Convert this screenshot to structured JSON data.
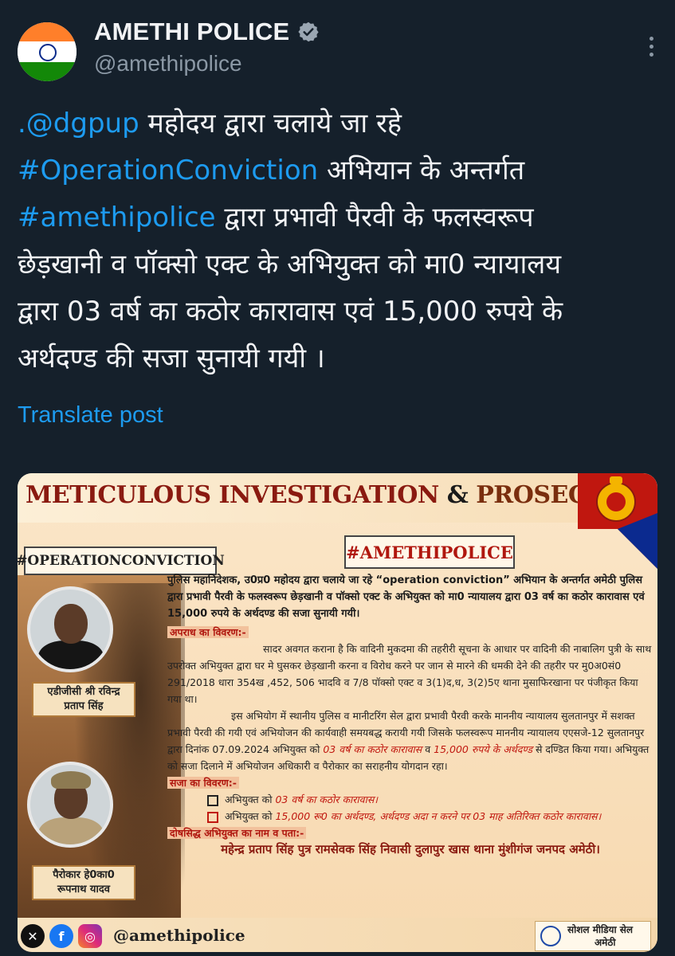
{
  "header": {
    "name": "AMETHI POLICE",
    "handle": "@amethipolice"
  },
  "tweet": {
    "lines": [
      {
        "link": ".@dgpup",
        "text": " महोदय द्वारा चलाये जा रहे"
      },
      {
        "link": "#OperationConviction",
        "text": " अभियान के अन्तर्गत"
      },
      {
        "link": "#amethipolice",
        "text": " द्वारा प्रभावी पैरवी के फलस्वरूप"
      },
      {
        "link": "",
        "text": "छेड़खानी व पॉक्सो एक्ट के अभियुक्त को मा0 न्यायालय"
      },
      {
        "link": "",
        "text": "द्वारा 03 वर्ष का कठोर कारावास एवं 15,000 रुपये के"
      },
      {
        "link": "",
        "text": "अर्थदण्ड की सजा सुनायी गयी ।"
      }
    ],
    "translate_label": "Translate post"
  },
  "card": {
    "title_a": "METICULOUS INVESTIGATION",
    "title_amp": " & ",
    "title_b": "PROSECUTION",
    "op_tag": "#OPERATIONCONVICTION",
    "ap_tag": "#AMETHIPOLICE",
    "person1": "एडीजीसी श्री रविन्द्र प्रताप सिंह",
    "person2": "पैरोकार हे0का0 रूपनाथ यादव",
    "intro": "पुलिस महानिदेशक, उ0प्र0 महोदय द्वारा चलाये जा रहे “operation conviction” अभियान के अन्तर्गत अमेठी पुलिस द्वारा प्रभावी पैरवी के फलस्वरूप छेड़खानी व पॉक्सो एक्ट के अभियुक्त को मा0 न्यायालय द्वारा 03 वर्ष का कठोर कारावास एवं 15,000 रुपये के अर्थदण्ड की सजा सुनायी गयी।",
    "heading_crime": "अपराध का विवरण:-",
    "para1": "सादर अवगत कराना है कि वादिनी मुकदमा की तहरीरी सूचना के आधार पर वादिनी की नाबालिग पुत्री के साथ उपरोक्त अभियुक्त द्वारा घर मे घुसकर छेड़खानी करना व विरोध करने पर जान से मारने की धमकी देने की तहरीर पर मु0अ0सं0 291/2018 धारा 354ख ,452, 506 भादवि व 7/8 पॉक्सो एक्ट व 3(1)द,ध, 3(2)5ए थाना मुसाफिरखाना पर पंजीकृत किया गया था।",
    "para2_a": "इस अभियोग में स्थानीय पुलिस व मानीटरिंग सेल द्वारा प्रभावी पैरवी करके माननीय न्यायालय सुलतानपुर में सशक्त प्रभावी पैरवी की गयी एवं अभियोजन की कार्यवाही समयबद्ध करायी गयी जिसके फलस्वरूप माननीय न्यायालय एएसजे-12 सुलतानपुर द्वारा दिनांक 07.09.2024 अभियुक्त को ",
    "para2_r1": "03 वर्ष का कठोर कारावास",
    "para2_b": " व ",
    "para2_r2": "15,000 रुपये के अर्थदण्ड",
    "para2_c": " से दण्डित किया गया। अभियुक्त को सजा दिलाने में अभियोजन अधिकारी व पैरोकार का सराहनीय योगदान रहा।",
    "heading_sentence": "सजा का विवरण:-",
    "s1_a": "अभियुक्त को ",
    "s1_r": "03 वर्ष का कठोर कारावास।",
    "s2_a": "अभियुक्त को ",
    "s2_r": "15,000 रू0 का अर्थदण्ड, अर्थदण्ड अदा न करने पर 03 माह अतिरिक्त कठोर कारावास।",
    "heading_accused": "दोषसिद्ध अभियुक्त का नाम व पता:-",
    "accused": "महेन्द्र प्रताप सिंह पुत्र रामसेवक सिंह निवासी दुलापुर खास थाना मुंशीगंज जनपद अमेठी।",
    "social_handle": "@amethipolice",
    "cell_line1": "सोशल मीडिया सेल",
    "cell_line2": "अमेठी"
  },
  "colors": {
    "background": "#15202b",
    "link": "#1d9bf0",
    "handle_gray": "#8b98a5",
    "accent_red": "#c0170f"
  },
  "icons": [
    "verified-badge-icon",
    "more-dots-icon",
    "x-logo-icon",
    "facebook-icon",
    "instagram-icon",
    "globe-icon"
  ]
}
